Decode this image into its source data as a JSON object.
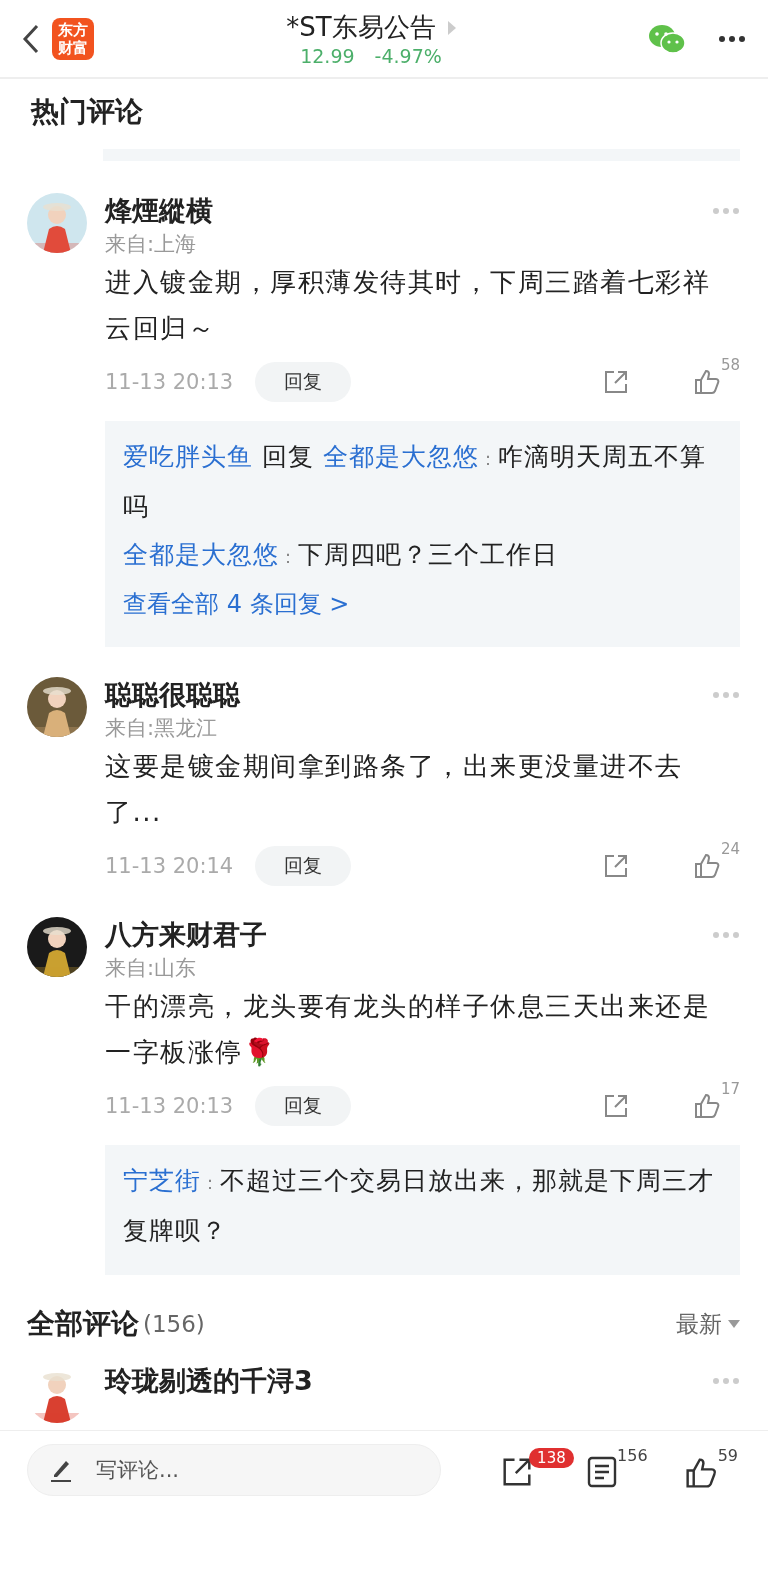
{
  "header": {
    "logo": "东方财富",
    "title": "*ST东易公告",
    "price": "12.99",
    "change": "-4.97%"
  },
  "hot_section": {
    "title": "热门评论"
  },
  "comments": [
    {
      "user": "烽煙縱横",
      "location": "来自:上海",
      "text": "进入镀金期，厚积薄发待其时，下周三踏着七彩祥云回归～",
      "time": "11-13 20:13",
      "reply_button": "回复",
      "likes": "58",
      "replies": [
        {
          "parts": [
            {
              "kind": "user",
              "text": "爱吃胖头鱼"
            },
            {
              "kind": "text",
              "text": " 回复 "
            },
            {
              "kind": "user",
              "text": "全都是大忽悠"
            },
            {
              "kind": "sep",
              "text": "："
            },
            {
              "kind": "text",
              "text": "咋滴明天周五不算吗"
            }
          ]
        },
        {
          "parts": [
            {
              "kind": "user",
              "text": "全都是大忽悠"
            },
            {
              "kind": "sep",
              "text": "："
            },
            {
              "kind": "text",
              "text": "下周四吧？三个工作日"
            }
          ]
        }
      ],
      "view_all": "查看全部 4 条回复 >"
    },
    {
      "user": "聪聪很聪聪",
      "location": "来自:黑龙江",
      "text": "这要是镀金期间拿到路条了，出来更没量进不去了...",
      "time": "11-13 20:14",
      "reply_button": "回复",
      "likes": "24"
    },
    {
      "user": "八方来财君子",
      "location": "来自:山东",
      "text": "干的漂亮，龙头要有龙头的样子休息三天出来还是一字板涨停🌹",
      "time": "11-13 20:13",
      "reply_button": "回复",
      "likes": "17",
      "replies": [
        {
          "parts": [
            {
              "kind": "user",
              "text": "宁芝街"
            },
            {
              "kind": "sep",
              "text": "："
            },
            {
              "kind": "text",
              "text": "不超过三个交易日放出来，那就是下周三才复牌呗？"
            }
          ]
        }
      ]
    }
  ],
  "all_section": {
    "title": "全部评论",
    "count": "(156)",
    "sort": "最新"
  },
  "partial_comment": {
    "user": "玲珑剔透的千浔3"
  },
  "bottom_bar": {
    "placeholder": "写评论...",
    "share_badge": "138",
    "comments_count": "156",
    "likes_count": "59"
  }
}
